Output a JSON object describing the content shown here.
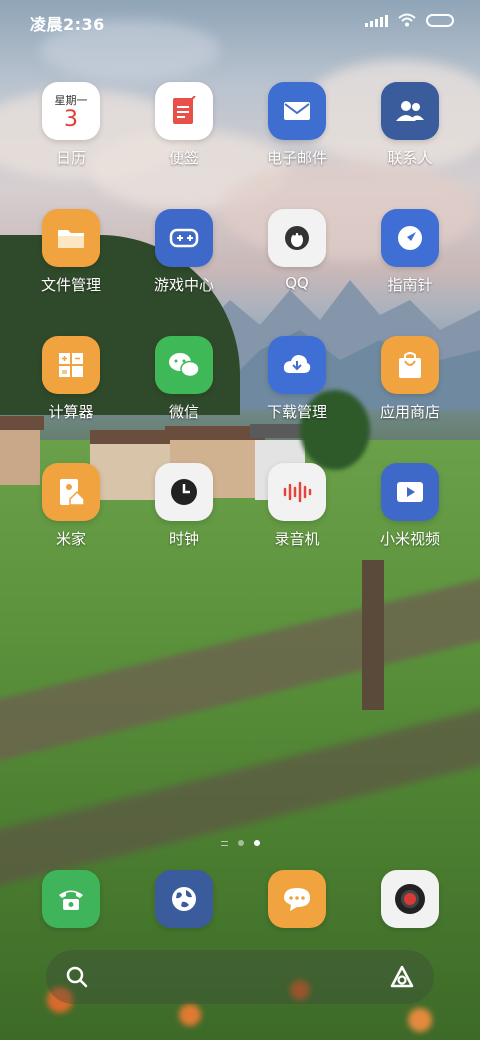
{
  "status_bar": {
    "time": "凌晨2:36"
  },
  "calendar_widget": {
    "weekday": "星期一",
    "day": "3"
  },
  "apps": [
    {
      "label": "日历",
      "icon": "calendar-icon",
      "color": "#ffffff"
    },
    {
      "label": "便签",
      "icon": "notes-icon",
      "color": "#ffffff"
    },
    {
      "label": "电子邮件",
      "icon": "mail-icon",
      "color": "#3e6fd0"
    },
    {
      "label": "联系人",
      "icon": "contacts-icon",
      "color": "#3a5c9c"
    },
    {
      "label": "文件管理",
      "icon": "folder-icon",
      "color": "#f0a33e"
    },
    {
      "label": "游戏中心",
      "icon": "gamepad-icon",
      "color": "#3f69c9"
    },
    {
      "label": "QQ",
      "icon": "qq-penguin-icon",
      "color": "#f2f2f2"
    },
    {
      "label": "指南针",
      "icon": "compass-icon",
      "color": "#3f6fd4"
    },
    {
      "label": "计算器",
      "icon": "calculator-icon",
      "color": "#f0a33e"
    },
    {
      "label": "微信",
      "icon": "wechat-icon",
      "color": "#3fb957"
    },
    {
      "label": "下载管理",
      "icon": "download-icon",
      "color": "#3f6fd4"
    },
    {
      "label": "应用商店",
      "icon": "store-bag-icon",
      "color": "#f0a33e"
    },
    {
      "label": "米家",
      "icon": "mijia-home-icon",
      "color": "#f0a33e"
    },
    {
      "label": "时钟",
      "icon": "clock-icon",
      "color": "#f2f2f2"
    },
    {
      "label": "录音机",
      "icon": "recorder-icon",
      "color": "#f2f2f2"
    },
    {
      "label": "小米视频",
      "icon": "video-play-icon",
      "color": "#3f69c9"
    }
  ],
  "dock": [
    {
      "icon": "phone-icon",
      "color": "#3fb45a"
    },
    {
      "icon": "browser-globe-icon",
      "color": "#3a5c9c"
    },
    {
      "icon": "messages-icon",
      "color": "#f0a33e"
    },
    {
      "icon": "camera-icon",
      "color": "#f2f2f2"
    }
  ],
  "page_indicator": {
    "pages": 2,
    "active": 2
  },
  "search_bar": {
    "left_icon": "search-icon",
    "right_icon": "assistant-icon"
  }
}
